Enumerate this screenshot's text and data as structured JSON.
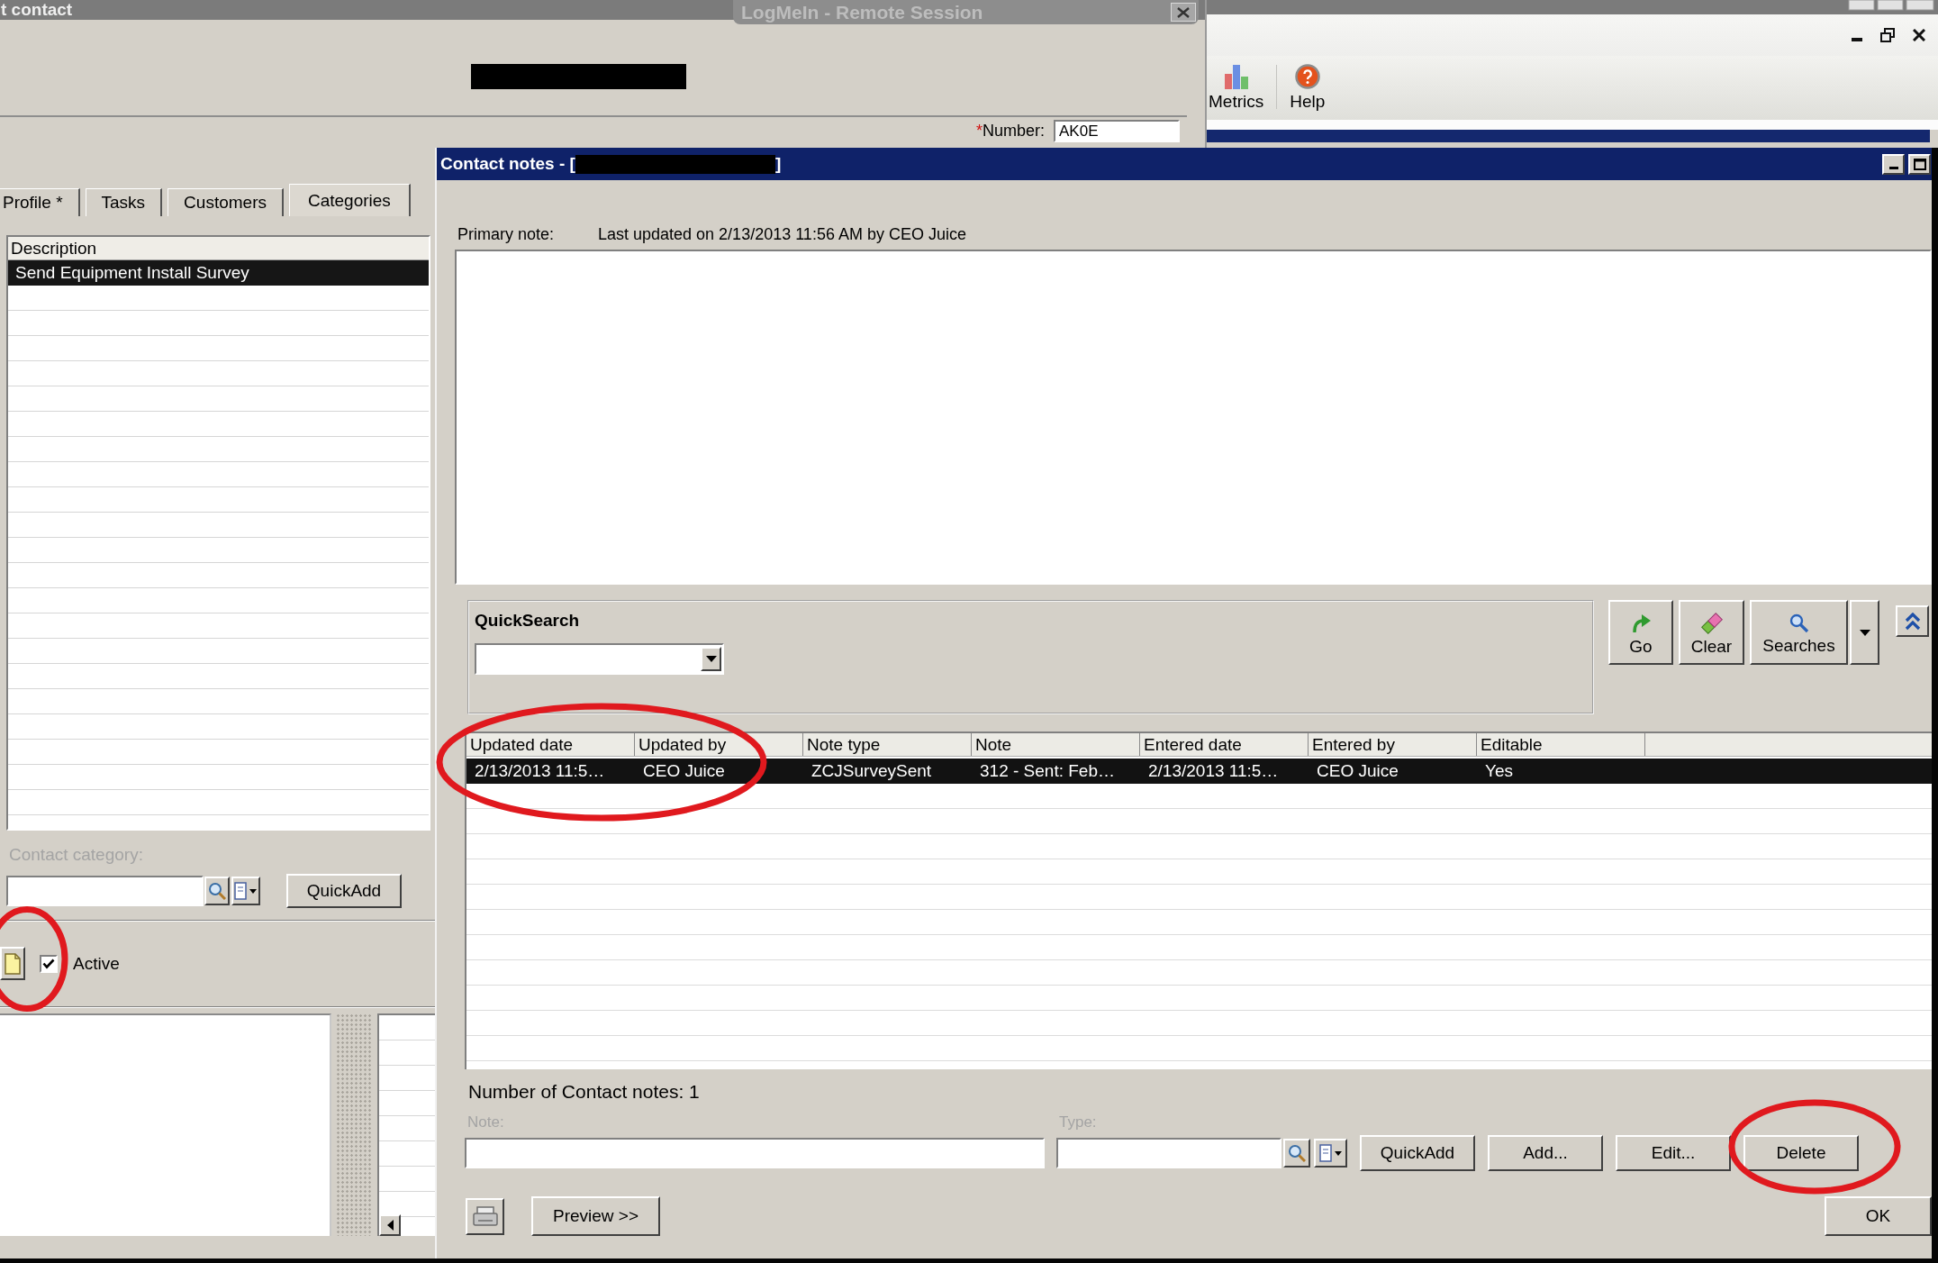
{
  "contact_window": {
    "title": "t contact",
    "number_field": {
      "required_mark": "*",
      "label": "Number:",
      "value": "AK0E"
    },
    "tabs": [
      {
        "label": "Profile *",
        "selected": false
      },
      {
        "label": "Tasks",
        "selected": false
      },
      {
        "label": "Customers",
        "selected": false
      },
      {
        "label": "Categories",
        "selected": true
      }
    ],
    "categories_list": {
      "column": "Description",
      "rows": [
        {
          "text": "Send Equipment Install Survey",
          "selected": true
        }
      ]
    },
    "category_field": {
      "label": "Contact category:",
      "disabled": true
    },
    "quickadd_button": "QuickAdd",
    "active_checkbox": {
      "label": "Active",
      "checked": true
    }
  },
  "remote_session_bar": {
    "title": "LogMeIn - Remote Session"
  },
  "app_toolbar": {
    "items": [
      {
        "label": "Metrics",
        "kind": "chart"
      },
      {
        "label": "Help",
        "kind": "help"
      }
    ]
  },
  "notes_dialog": {
    "title": "Contact notes - [",
    "title_end": "]",
    "primary_note": {
      "label": "Primary note:",
      "info": "Last updated on 2/13/2013 11:56 AM by CEO Juice"
    },
    "quick_search": {
      "label": "QuickSearch"
    },
    "search_buttons": [
      {
        "label": "Go",
        "kind": "go"
      },
      {
        "label": "Clear",
        "kind": "clear"
      },
      {
        "label": "Searches",
        "kind": "searches"
      }
    ],
    "table": {
      "columns": [
        "Updated date",
        "Updated by",
        "Note type",
        "Note",
        "Entered date",
        "Entered by",
        "Editable"
      ],
      "rows": [
        {
          "cells": [
            "2/13/2013 11:5…",
            "CEO Juice",
            "ZCJSurveySent",
            "312 - Sent: Feb…",
            "2/13/2013 11:5…",
            "CEO Juice",
            "Yes"
          ],
          "selected": true
        }
      ]
    },
    "count": "Number of Contact notes: 1",
    "note_field": {
      "label": "Note:",
      "disabled": true
    },
    "type_field": {
      "label": "Type:",
      "disabled": true
    },
    "actions": [
      "QuickAdd",
      "Add...",
      "Edit...",
      "Delete"
    ],
    "preview_button": "Preview >>",
    "ok_button": "OK"
  }
}
